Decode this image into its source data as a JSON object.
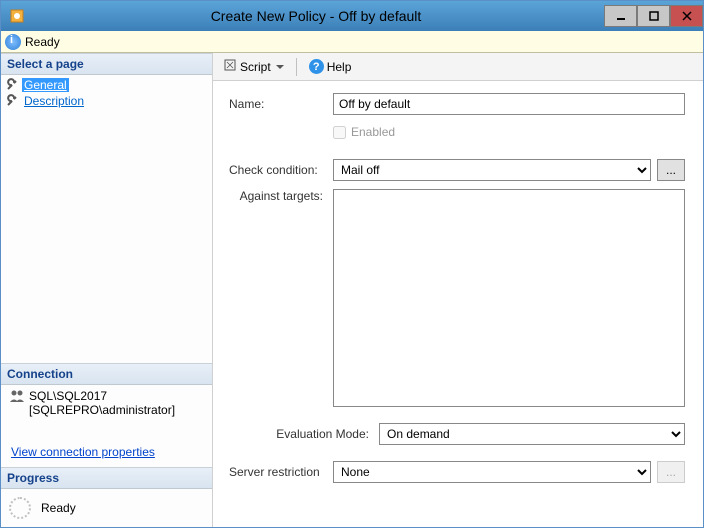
{
  "window": {
    "title": "Create New Policy - Off by default"
  },
  "status": {
    "text": "Ready"
  },
  "sidebar": {
    "select_page_header": "Select a page",
    "items": [
      {
        "label": "General"
      },
      {
        "label": "Description"
      }
    ],
    "connection_header": "Connection",
    "connection": {
      "server": "SQL\\SQL2017",
      "user": "[SQLREPRO\\administrator]"
    },
    "view_conn_link": "View connection properties",
    "progress_header": "Progress",
    "progress_text": "Ready"
  },
  "toolbar": {
    "script_label": "Script",
    "help_label": "Help"
  },
  "form": {
    "name_label": "Name:",
    "name_value": "Off by default",
    "enabled_label": "Enabled",
    "check_condition_label": "Check condition:",
    "check_condition_value": "Mail off",
    "against_targets_label": "Against targets:",
    "evaluation_mode_label": "Evaluation Mode:",
    "evaluation_mode_value": "On demand",
    "server_restriction_label": "Server restriction",
    "server_restriction_value": "None",
    "dots": "..."
  }
}
